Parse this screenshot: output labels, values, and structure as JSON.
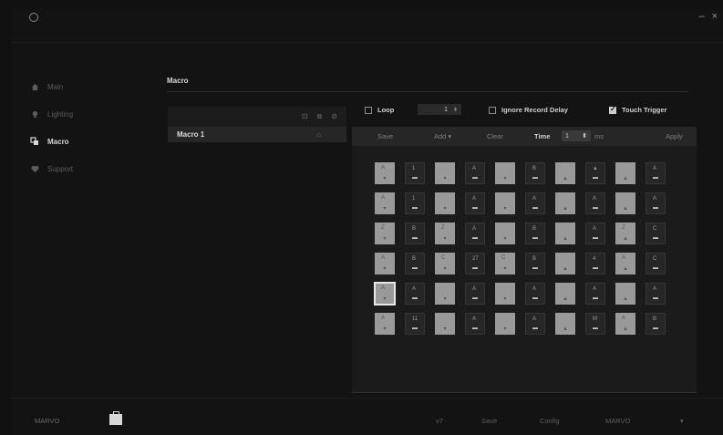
{
  "window": {
    "minimize_icon": "minimize-icon",
    "close_icon": "close-icon",
    "minimize": "–",
    "close": "×"
  },
  "sidebar": {
    "items": [
      {
        "label": "Main",
        "icon": "home-icon"
      },
      {
        "label": "Lighting",
        "icon": "bulb-icon"
      },
      {
        "label": "Macro",
        "icon": "macro-icon"
      },
      {
        "label": "Support",
        "icon": "heart-icon"
      }
    ],
    "active_index": 2
  },
  "macro": {
    "section_title": "Macro",
    "list": {
      "tools": [
        "⊡",
        "⧉",
        "⊘"
      ],
      "items": [
        {
          "name": "Macro 1",
          "icon": "⌂"
        }
      ]
    },
    "options": {
      "loop_label": "Loop",
      "loop_checked": false,
      "loop_value": "1",
      "ignore_label": "Ignore Record Delay",
      "ignore_checked": false,
      "touch_label": "Touch Trigger",
      "touch_checked": true
    },
    "actions": {
      "save": "Save",
      "add": "Add ▾",
      "clear": "Clear",
      "delay_label": "Time",
      "delay_value": "1",
      "delay_unit": "ms",
      "apply": "Apply"
    },
    "keys": [
      {
        "top": "A",
        "bottom": "▾",
        "style": "light"
      },
      {
        "top": "1",
        "bottom": "▬",
        "style": "dark"
      },
      {
        "top": "",
        "bottom": "▾",
        "style": "light"
      },
      {
        "top": "A",
        "bottom": "▬",
        "style": "dark"
      },
      {
        "top": "",
        "bottom": "▾",
        "style": "light"
      },
      {
        "top": "B",
        "bottom": "▬",
        "style": "dark"
      },
      {
        "top": "",
        "bottom": "▲",
        "style": "light"
      },
      {
        "top": "▲",
        "bottom": "▬",
        "style": "dark"
      },
      {
        "top": "",
        "bottom": "▲",
        "style": "light"
      },
      {
        "top": "A",
        "bottom": "▬",
        "style": "dark"
      },
      {
        "top": "A",
        "bottom": "▾",
        "style": "light"
      },
      {
        "top": "1",
        "bottom": "▬",
        "style": "dark"
      },
      {
        "top": "",
        "bottom": "▾",
        "style": "light"
      },
      {
        "top": "A",
        "bottom": "▬",
        "style": "dark"
      },
      {
        "top": "",
        "bottom": "▾",
        "style": "light"
      },
      {
        "top": "A",
        "bottom": "▬",
        "style": "dark"
      },
      {
        "top": "",
        "bottom": "▲",
        "style": "light"
      },
      {
        "top": "A",
        "bottom": "▬",
        "style": "dark"
      },
      {
        "top": "",
        "bottom": "▲",
        "style": "light"
      },
      {
        "top": "A",
        "bottom": "▬",
        "style": "dark"
      },
      {
        "top": "Z",
        "bottom": "▾",
        "style": "light"
      },
      {
        "top": "B",
        "bottom": "▬",
        "style": "dark"
      },
      {
        "top": "Z",
        "bottom": "▾",
        "style": "light"
      },
      {
        "top": "A",
        "bottom": "▬",
        "style": "dark"
      },
      {
        "top": "",
        "bottom": "▾",
        "style": "light"
      },
      {
        "top": "B",
        "bottom": "▬",
        "style": "dark"
      },
      {
        "top": "",
        "bottom": "▲",
        "style": "light"
      },
      {
        "top": "A",
        "bottom": "▬",
        "style": "dark"
      },
      {
        "top": "Z",
        "bottom": "▲",
        "style": "light"
      },
      {
        "top": "C",
        "bottom": "▬",
        "style": "dark"
      },
      {
        "top": "A",
        "bottom": "▾",
        "style": "light"
      },
      {
        "top": "B",
        "bottom": "▬",
        "style": "dark"
      },
      {
        "top": "C",
        "bottom": "▾",
        "style": "light"
      },
      {
        "top": "27",
        "bottom": "▬",
        "style": "dark"
      },
      {
        "top": "C",
        "bottom": "▾",
        "style": "light"
      },
      {
        "top": "B",
        "bottom": "▬",
        "style": "dark"
      },
      {
        "top": "",
        "bottom": "▲",
        "style": "light"
      },
      {
        "top": "4",
        "bottom": "▬",
        "style": "dark"
      },
      {
        "top": "A",
        "bottom": "▲",
        "style": "light"
      },
      {
        "top": "C",
        "bottom": "▬",
        "style": "dark"
      },
      {
        "top": "A",
        "bottom": "▾",
        "style": "light",
        "selected": true
      },
      {
        "top": "A",
        "bottom": "▬",
        "style": "dark"
      },
      {
        "top": "",
        "bottom": "▾",
        "style": "light"
      },
      {
        "top": "A",
        "bottom": "▬",
        "style": "dark"
      },
      {
        "top": "",
        "bottom": "▾",
        "style": "light"
      },
      {
        "top": "A",
        "bottom": "▬",
        "style": "dark"
      },
      {
        "top": "",
        "bottom": "▲",
        "style": "light"
      },
      {
        "top": "A",
        "bottom": "▬",
        "style": "dark"
      },
      {
        "top": "",
        "bottom": "▲",
        "style": "light"
      },
      {
        "top": "A",
        "bottom": "▬",
        "style": "dark"
      },
      {
        "top": "A",
        "bottom": "▾",
        "style": "light"
      },
      {
        "top": "11",
        "bottom": "▬",
        "style": "dark"
      },
      {
        "top": "",
        "bottom": "▾",
        "style": "light"
      },
      {
        "top": "A",
        "bottom": "▬",
        "style": "dark"
      },
      {
        "top": "",
        "bottom": "▾",
        "style": "light"
      },
      {
        "top": "A",
        "bottom": "▬",
        "style": "dark"
      },
      {
        "top": "",
        "bottom": "▲",
        "style": "light"
      },
      {
        "top": "M",
        "bottom": "▬",
        "style": "dark"
      },
      {
        "top": "A",
        "bottom": "▲",
        "style": "light"
      },
      {
        "top": "B",
        "bottom": "▬",
        "style": "dark"
      }
    ]
  },
  "statusbar": {
    "brand": "MARVO",
    "firmware": "v7",
    "save": "Save",
    "config": "Config",
    "model": "MARVO",
    "more": "▾"
  }
}
